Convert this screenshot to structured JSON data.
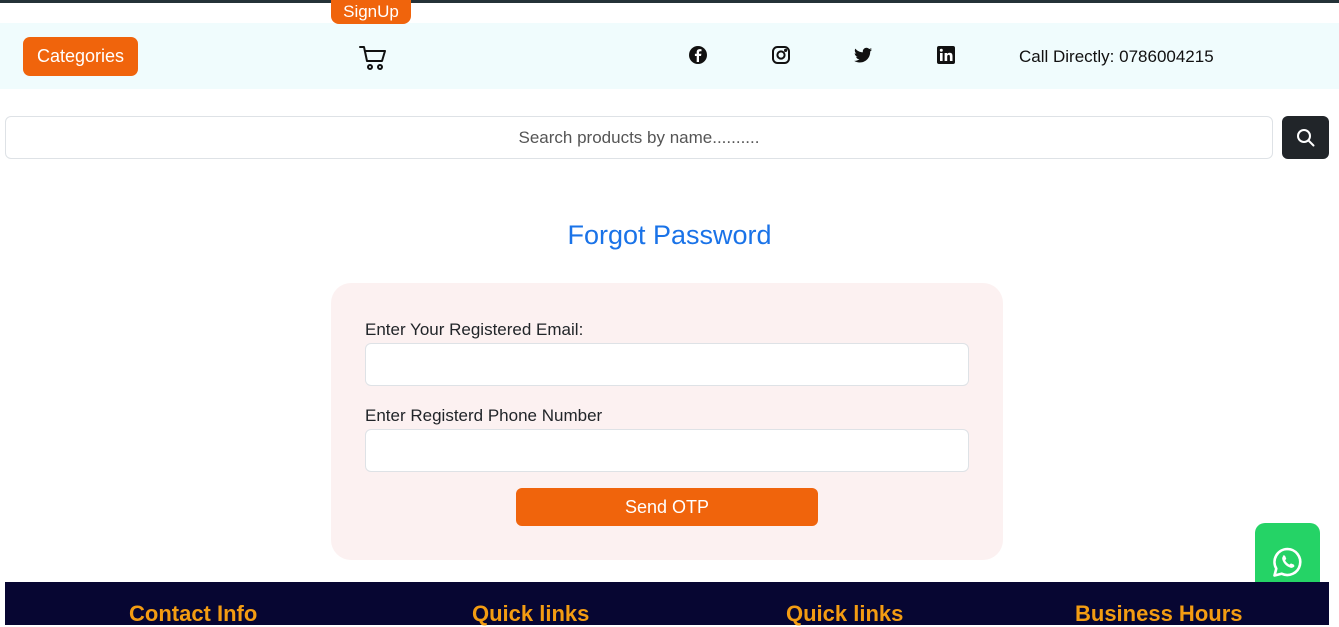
{
  "header": {
    "signup_label": "SignUp",
    "categories_label": "Categories",
    "call_text": "Call Directly: 0786004215"
  },
  "search": {
    "placeholder": "Search products by name.........."
  },
  "main": {
    "title": "Forgot Password",
    "email_label": "Enter Your Registered Email:",
    "phone_label": "Enter Registerd Phone Number",
    "send_otp_label": "Send OTP"
  },
  "footer": {
    "headings": [
      "Contact Info",
      "Quick links",
      "Quick links",
      "Business Hours"
    ]
  },
  "icons": [
    "cart-icon",
    "facebook-icon",
    "instagram-icon",
    "twitter-icon",
    "linkedin-icon",
    "search-icon",
    "whatsapp-icon"
  ],
  "colors": {
    "accent": "#f0640c",
    "title": "#1a73e8",
    "footer_bg": "#070632",
    "footer_heading": "#f39c12",
    "whatsapp": "#25d366"
  }
}
